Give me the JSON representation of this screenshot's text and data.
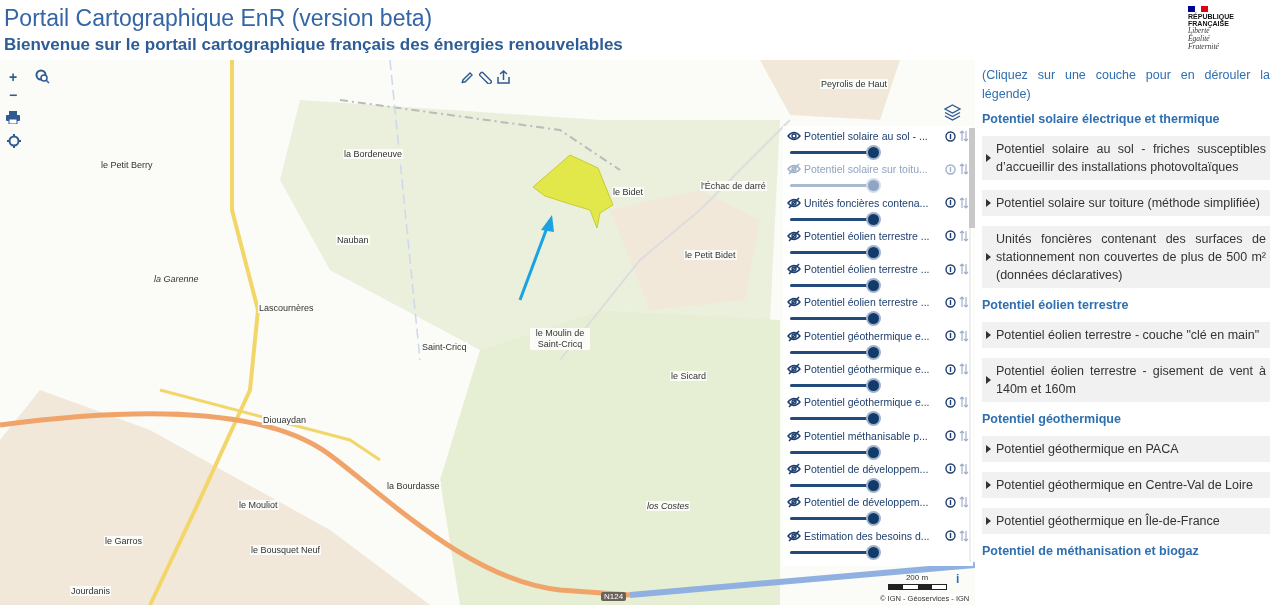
{
  "header": {
    "title": "Portail Cartographique EnR (version beta)",
    "subtitle": "Bienvenue sur le portail cartographique français des énergies renouvelables",
    "logo": {
      "name": "RÉPUBLIQUE FRANÇAISE",
      "motto": [
        "Liberté",
        "Égalité",
        "Fraternité"
      ]
    }
  },
  "map": {
    "places": [
      {
        "label": "Peyrolis de Haut",
        "kind": "place"
      },
      {
        "label": "la Bordeneuve",
        "kind": "place"
      },
      {
        "label": "le Petit Berry",
        "kind": "place"
      },
      {
        "label": "le Bidet",
        "kind": "place"
      },
      {
        "label": "l'Échac de darré",
        "kind": "place"
      },
      {
        "label": "Nauban",
        "kind": "place"
      },
      {
        "label": "le Petit Bidet",
        "kind": "place"
      },
      {
        "label": "la Garenne",
        "kind": "locality"
      },
      {
        "label": "Lascournères",
        "kind": "place"
      },
      {
        "label": "Saint-Cricq",
        "kind": "place"
      },
      {
        "label": "le Moulin de Saint-Cricq",
        "kind": "place"
      },
      {
        "label": "le Sicard",
        "kind": "place"
      },
      {
        "label": "Diouaydan",
        "kind": "place"
      },
      {
        "label": "la Bourdasse",
        "kind": "place"
      },
      {
        "label": "le Mouliot",
        "kind": "place"
      },
      {
        "label": "los Costes",
        "kind": "locality"
      },
      {
        "label": "le Garros",
        "kind": "place"
      },
      {
        "label": "le Bousquet Neuf",
        "kind": "place"
      },
      {
        "label": "Jourdanis",
        "kind": "place"
      }
    ],
    "road_badge": "N124",
    "zoom_in": "+",
    "zoom_out": "−",
    "scale": "200 m",
    "info": "i",
    "attribution": "© IGN - Géoservices - IGN",
    "layers": [
      {
        "name": "Potentiel solaire au sol - ...",
        "visible": true,
        "disabled": false,
        "level": 0.95
      },
      {
        "name": "Potentiel solaire sur toitu...",
        "visible": false,
        "disabled": true,
        "level": 0.95
      },
      {
        "name": "Unités foncières contena...",
        "visible": false,
        "disabled": false,
        "level": 0.95
      },
      {
        "name": "Potentiel éolien terrestre ...",
        "visible": false,
        "disabled": false,
        "level": 0.95
      },
      {
        "name": "Potentiel éolien terrestre ...",
        "visible": false,
        "disabled": false,
        "level": 0.95
      },
      {
        "name": "Potentiel éolien terrestre ...",
        "visible": false,
        "disabled": false,
        "level": 0.95
      },
      {
        "name": "Potentiel géothermique e...",
        "visible": false,
        "disabled": false,
        "level": 0.95
      },
      {
        "name": "Potentiel géothermique e...",
        "visible": false,
        "disabled": false,
        "level": 0.95
      },
      {
        "name": "Potentiel géothermique e...",
        "visible": false,
        "disabled": false,
        "level": 0.95
      },
      {
        "name": "Potentiel méthanisable p...",
        "visible": false,
        "disabled": false,
        "level": 0.95
      },
      {
        "name": "Potentiel de développem...",
        "visible": false,
        "disabled": false,
        "level": 0.95
      },
      {
        "name": "Potentiel de développem...",
        "visible": false,
        "disabled": false,
        "level": 0.95
      },
      {
        "name": "Estimation des besoins d...",
        "visible": false,
        "disabled": false,
        "level": 0.95
      }
    ]
  },
  "legend": {
    "intro": "(Cliquez sur une couche pour en dérouler la légende)",
    "groups": [
      {
        "title": "Potentiel solaire électrique et thermique",
        "items": [
          {
            "label": "Potentiel solaire au sol - friches susceptibles d’accueillir des installations photovoltaïques",
            "expanded": false
          },
          {
            "label": "Potentiel solaire sur toiture (méthode simplifiée)",
            "expanded": false
          },
          {
            "label": "Unités foncières contenant des surfaces de stationnement non couvertes de plus de 500 m² (données déclaratives)",
            "expanded": false
          }
        ]
      },
      {
        "title": "Potentiel éolien terrestre",
        "items": [
          {
            "label": "Potentiel éolien terrestre - couche \"clé en main\"",
            "expanded": false
          },
          {
            "label": "Potentiel éolien terrestre - gisement de vent à 140m et 160m",
            "expanded": false
          }
        ]
      },
      {
        "title": "Potentiel géothermique",
        "items": [
          {
            "label": "Potentiel géothermique en PACA",
            "expanded": false
          },
          {
            "label": "Potentiel géothermique en Centre-Val de Loire",
            "expanded": false
          },
          {
            "label": "Potentiel géothermique en Île-de-France",
            "expanded": false
          }
        ]
      },
      {
        "title": "Potentiel de méthanisation et biogaz"
      }
    ]
  }
}
